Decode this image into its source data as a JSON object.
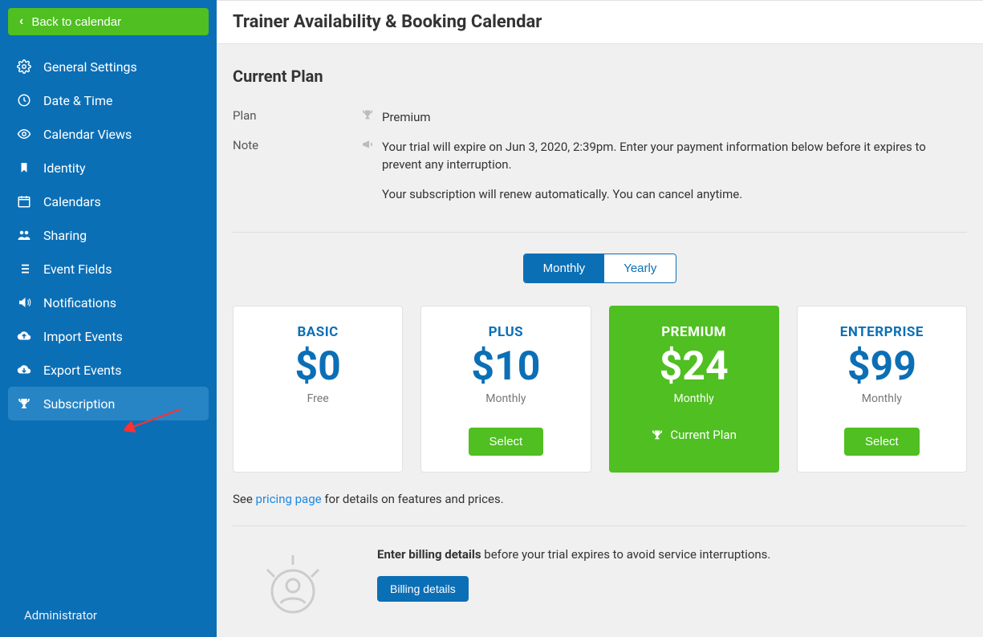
{
  "back_button": {
    "label": "Back to calendar"
  },
  "sidebar": {
    "items": [
      {
        "label": "General Settings",
        "icon": "gear-icon"
      },
      {
        "label": "Date & Time",
        "icon": "clock-icon"
      },
      {
        "label": "Calendar Views",
        "icon": "eye-icon"
      },
      {
        "label": "Identity",
        "icon": "bookmark-icon"
      },
      {
        "label": "Calendars",
        "icon": "calendar-icon"
      },
      {
        "label": "Sharing",
        "icon": "people-icon"
      },
      {
        "label": "Event Fields",
        "icon": "list-icon"
      },
      {
        "label": "Notifications",
        "icon": "speaker-icon"
      },
      {
        "label": "Import Events",
        "icon": "cloud-up-icon"
      },
      {
        "label": "Export Events",
        "icon": "cloud-down-icon"
      },
      {
        "label": "Subscription",
        "icon": "trophy-icon"
      }
    ],
    "active_index": 10,
    "footer_label": "Administrator"
  },
  "header": {
    "title": "Trainer Availability & Booking Calendar"
  },
  "current_plan": {
    "section_title": "Current Plan",
    "rows": {
      "plan_label": "Plan",
      "plan_value": "Premium",
      "note_label": "Note",
      "note_line1": "Your trial will expire on Jun 3, 2020, 2:39pm. Enter your payment information below before it expires to prevent any interruption.",
      "note_line2": "Your subscription will renew automatically. You can cancel anytime."
    }
  },
  "billing_toggle": {
    "monthly": "Monthly",
    "yearly": "Yearly",
    "active": "monthly"
  },
  "plans": [
    {
      "name": "BASIC",
      "price": "$0",
      "interval": "Free",
      "action": "none"
    },
    {
      "name": "PLUS",
      "price": "$10",
      "interval": "Monthly",
      "action": "select"
    },
    {
      "name": "PREMIUM",
      "price": "$24",
      "interval": "Monthly",
      "action": "current"
    },
    {
      "name": "ENTERPRISE",
      "price": "$99",
      "interval": "Monthly",
      "action": "select"
    }
  ],
  "plan_labels": {
    "select": "Select",
    "current": "Current Plan"
  },
  "pricing_note": {
    "prefix": "See ",
    "link": "pricing page",
    "suffix": " for details on features and prices."
  },
  "billing": {
    "heading_strong": "Enter billing details",
    "heading_rest": " before your trial expires to avoid service interruptions.",
    "button": "Billing details"
  },
  "colors": {
    "sidebar_bg": "#0b6fb6",
    "green": "#4fbf21",
    "link": "#1e88e5"
  }
}
